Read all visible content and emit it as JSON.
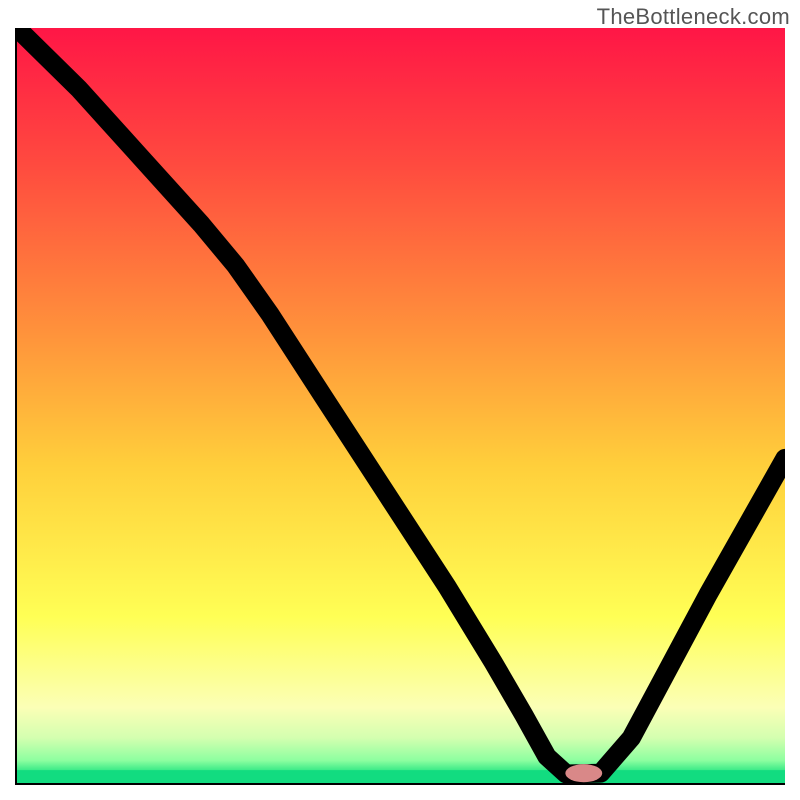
{
  "watermark": "TheBottleneck.com",
  "chart_data": {
    "type": "line",
    "title": "",
    "xlabel": "",
    "ylabel": "",
    "xlim": [
      0,
      100
    ],
    "ylim": [
      0,
      100
    ],
    "grid": false,
    "background_gradient": {
      "description": "vertical red-to-green gradient (bottleneck-style)",
      "stops": [
        {
          "offset": 0.0,
          "color": "#ff1646"
        },
        {
          "offset": 0.18,
          "color": "#ff4a3f"
        },
        {
          "offset": 0.4,
          "color": "#ff913b"
        },
        {
          "offset": 0.58,
          "color": "#ffcf3b"
        },
        {
          "offset": 0.78,
          "color": "#ffff55"
        },
        {
          "offset": 0.9,
          "color": "#fbffb6"
        },
        {
          "offset": 0.94,
          "color": "#d4ffb0"
        },
        {
          "offset": 0.97,
          "color": "#8dffa0"
        },
        {
          "offset": 0.985,
          "color": "#30e884"
        },
        {
          "offset": 1.0,
          "color": "#12dc80"
        }
      ]
    },
    "series": [
      {
        "name": "bottleneck-curve",
        "x": [
          0.0,
          8.0,
          16.0,
          24.0,
          28.5,
          33.0,
          40.0,
          48.0,
          56.0,
          62.0,
          66.0,
          69.0,
          71.5,
          76.0,
          80.0,
          85.0,
          90.0,
          95.0,
          100.0
        ],
        "y": [
          100.0,
          92.0,
          83.0,
          74.0,
          68.5,
          62.0,
          51.0,
          38.5,
          26.0,
          16.0,
          9.0,
          3.5,
          1.2,
          1.3,
          6.0,
          15.5,
          25.0,
          34.0,
          43.0
        ]
      }
    ],
    "marker": {
      "name": "optimal-point",
      "x": 73.8,
      "y": 1.3,
      "rx": 2.4,
      "ry": 1.2,
      "color": "#d98888"
    }
  }
}
